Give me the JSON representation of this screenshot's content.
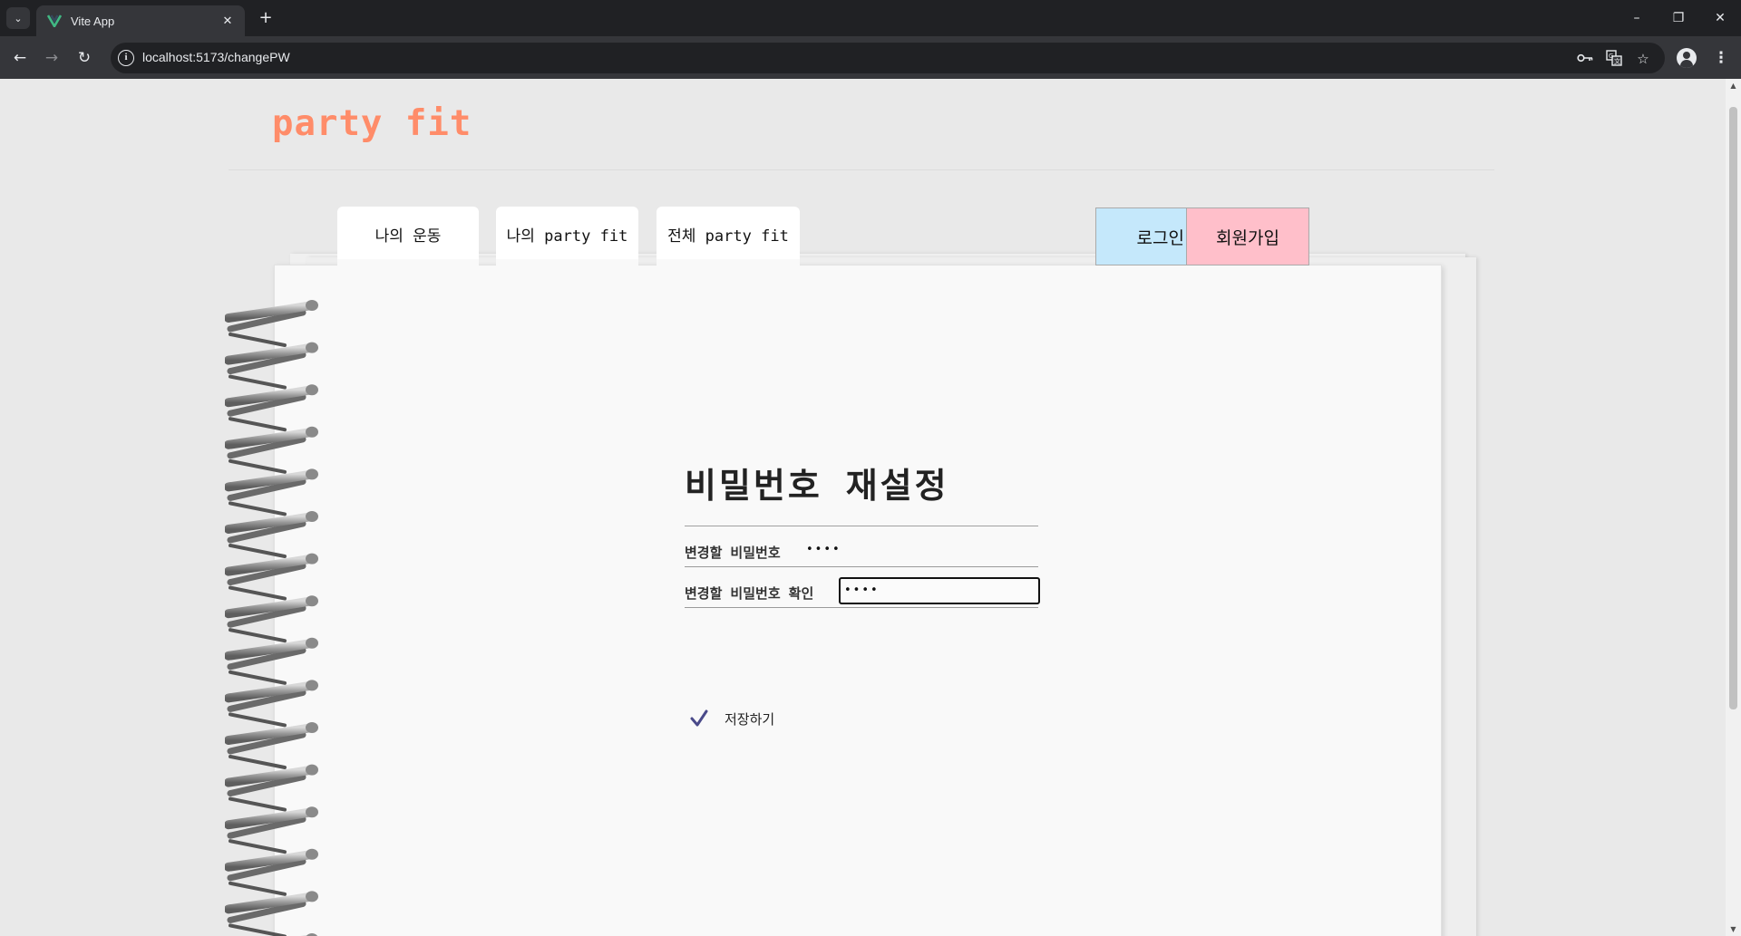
{
  "browser": {
    "tab_title": "Vite App",
    "tab_close_glyph": "✕",
    "new_tab_glyph": "+",
    "tab_list_glyph": "⌄",
    "url": "localhost:5173/changePW",
    "window_controls": {
      "minimize": "–",
      "restore": "❐",
      "close": "✕"
    },
    "nav": {
      "back": "←",
      "forward": "→",
      "reload": "↻"
    },
    "icons": [
      "info-icon",
      "password-key-icon",
      "translate-icon",
      "bookmark-star-icon",
      "profile-icon",
      "kebab-menu-icon"
    ]
  },
  "site": {
    "logo": "party fit",
    "logo_color": "#ff8c69"
  },
  "nav_tabs": [
    {
      "label": "나의 운동"
    },
    {
      "label": "나의 party fit"
    },
    {
      "label": "전체 party fit"
    }
  ],
  "auth": {
    "login_label": "로그인",
    "login_color": "#c5e8fb",
    "signup_label": "회원가입",
    "signup_color": "#ffbfca"
  },
  "form": {
    "title": "비밀번호 재설정",
    "new_password_label": "변경할 비밀번호",
    "new_password_value": "••••",
    "confirm_password_label": "변경할 비밀번호 확인",
    "confirm_password_value": "••••",
    "save_label": "저장하기",
    "check_icon_color": "#4a4a8a"
  }
}
